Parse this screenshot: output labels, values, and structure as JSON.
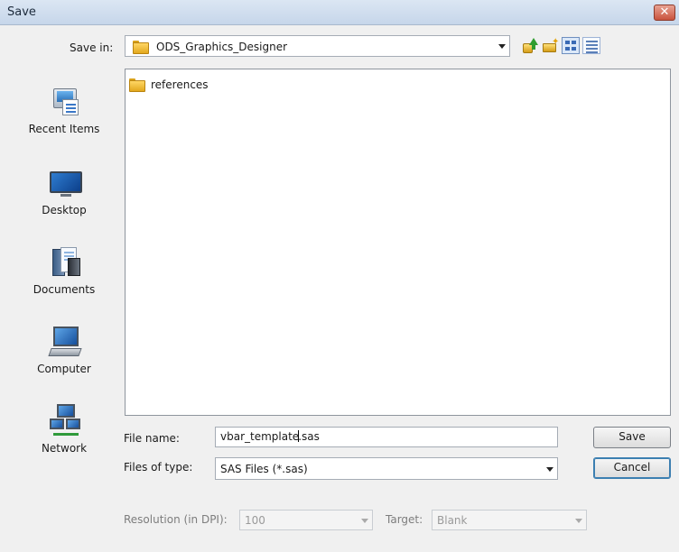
{
  "window": {
    "title": "Save",
    "close_glyph": "✕"
  },
  "save_in": {
    "label": "Save in:",
    "value": "ODS_Graphics_Designer"
  },
  "toolbar": {
    "icons": [
      "up-one-level-icon",
      "create-new-folder-icon",
      "list-view-icon",
      "details-view-icon"
    ]
  },
  "places": [
    {
      "label": "Recent Items",
      "icon": "recent-items-icon"
    },
    {
      "label": "Desktop",
      "icon": "desktop-icon"
    },
    {
      "label": "Documents",
      "icon": "documents-icon"
    },
    {
      "label": "Computer",
      "icon": "computer-icon"
    },
    {
      "label": "Network",
      "icon": "network-icon"
    }
  ],
  "files": [
    {
      "name": "references",
      "type": "folder"
    }
  ],
  "file_name": {
    "label": "File name:",
    "value_before_caret": "vbar_template",
    "value_after_caret": ".sas"
  },
  "file_type": {
    "label": "Files of type:",
    "value": "SAS Files (*.sas)"
  },
  "resolution": {
    "label": "Resolution (in DPI):",
    "value": "100"
  },
  "target": {
    "label": "Target:",
    "value": "Blank"
  },
  "buttons": {
    "save": "Save",
    "cancel": "Cancel"
  }
}
